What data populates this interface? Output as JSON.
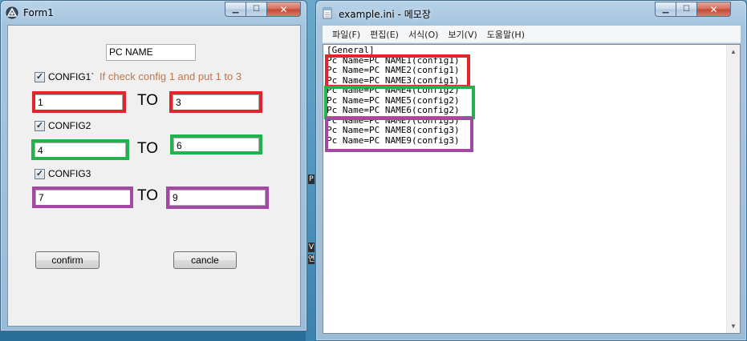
{
  "form1": {
    "title": "Form1",
    "caption": {
      "minimize": "▁",
      "maximize": "☐",
      "close": "✕"
    },
    "pc_name_input": "PC NAME",
    "config1": {
      "label": "CONFIG1`",
      "checked": "✓",
      "note": "If check config 1 and put 1 to 3",
      "from": "1",
      "to": "3"
    },
    "config2": {
      "label": "CONFIG2",
      "checked": "✓",
      "from": "4",
      "to": "6"
    },
    "config3": {
      "label": "CONFIG3",
      "checked": "✓",
      "from": "7",
      "to": "9"
    },
    "to_label": "TO",
    "confirm_label": "confirm",
    "cancel_label": "cancle"
  },
  "notepad": {
    "title": "example.ini - 메모장",
    "caption": {
      "minimize": "▁",
      "maximize": "☐",
      "close": "✕"
    },
    "menu": [
      "파일(F)",
      "편집(E)",
      "서식(O)",
      "보기(V)",
      "도움말(H)"
    ],
    "lines": [
      "[General]",
      "Pc Name=PC NAME1(config1)",
      "Pc Name=PC NAME2(config1)",
      "Pc Name=PC NAME3(config1)",
      "Pc Name=PC NAME4(config2)",
      "Pc Name=PC NAME5(config2)",
      "Pc Name=PC NAME6(config2)",
      "Pc Name=PC NAME7(config3)",
      "Pc Name=PC NAME8(config3)",
      "Pc Name=PC NAME9(config3)"
    ],
    "scroll": {
      "up": "▲",
      "down": "▼"
    }
  },
  "desktop": {
    "glyph_top": "P",
    "glyph_mid": "V",
    "glyph_low": "연"
  },
  "colors": {
    "red": "#e2242c",
    "green": "#22b14c",
    "purple": "#a349a4"
  }
}
